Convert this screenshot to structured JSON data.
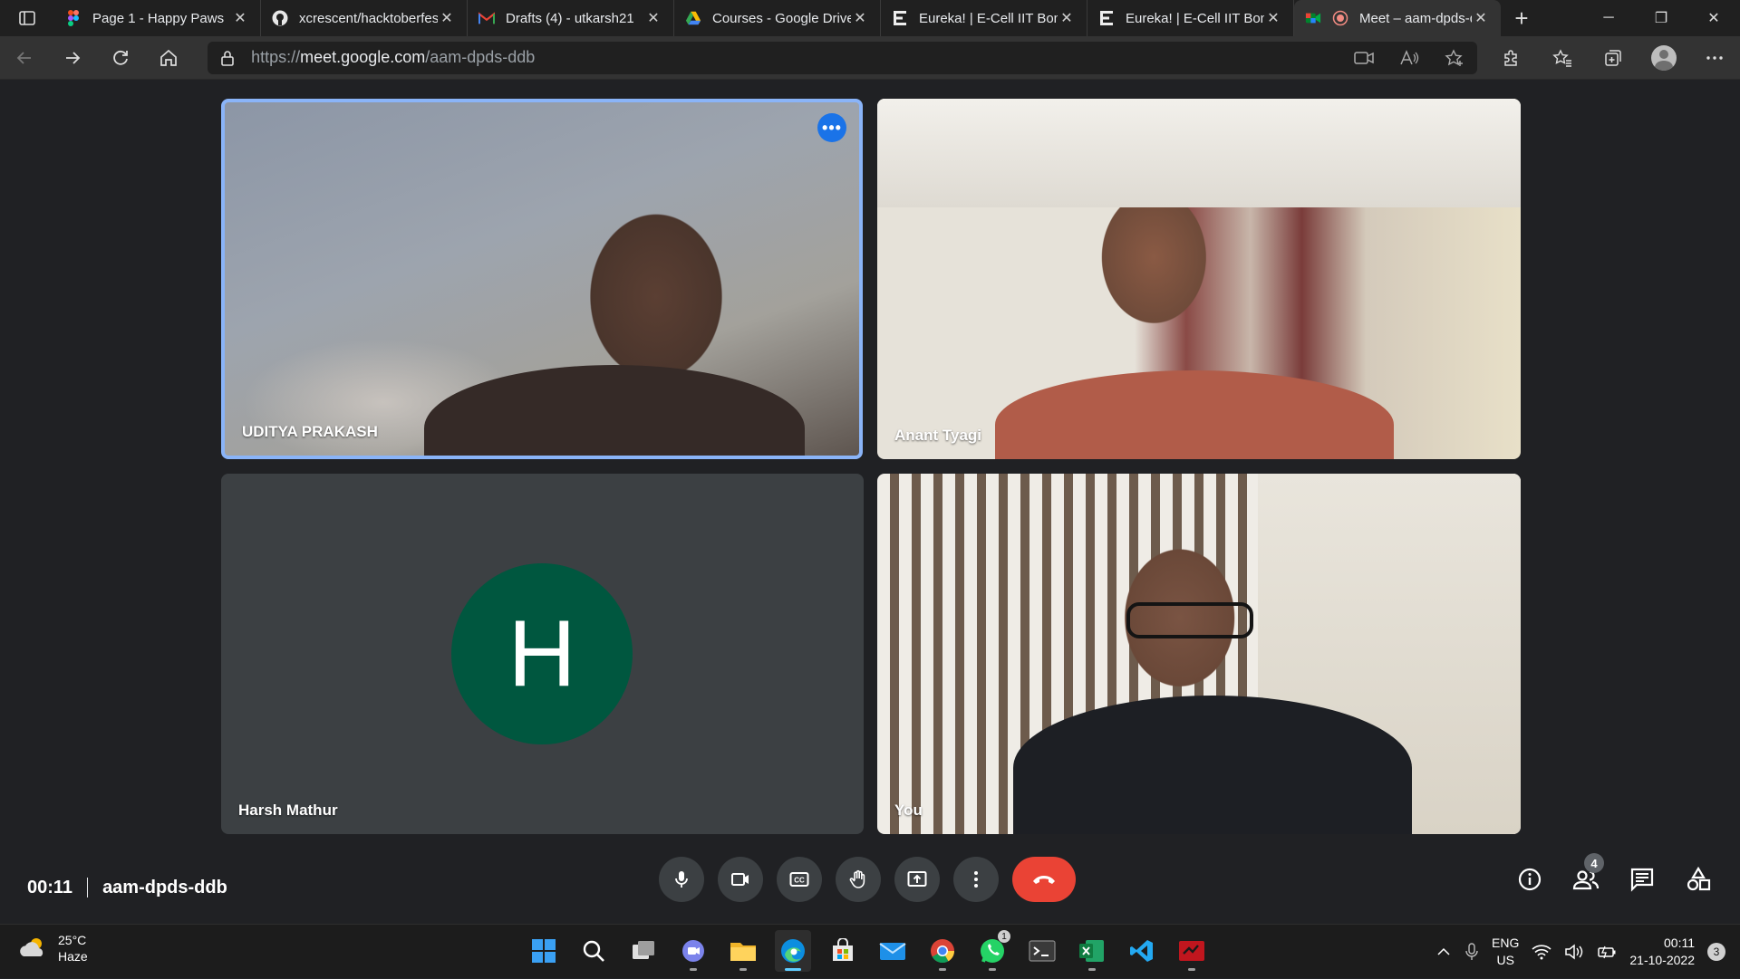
{
  "browser": {
    "tabs": [
      {
        "title": "Page 1 - Happy Paws",
        "icon": "figma-icon"
      },
      {
        "title": "xcrescent/hacktoberfest",
        "icon": "github-icon"
      },
      {
        "title": "Drafts (4) - utkarsh21",
        "icon": "gmail-icon"
      },
      {
        "title": "Courses - Google Drive",
        "icon": "google-drive-icon"
      },
      {
        "title": "Eureka! | E-Cell IIT Bombay",
        "icon": "eureka-icon"
      },
      {
        "title": "Eureka! | E-Cell IIT Bombay",
        "icon": "eureka-icon"
      },
      {
        "title": "Meet – aam-dpds-ddb",
        "icon": "google-meet-icon"
      }
    ],
    "close_glyph": "✕",
    "new_tab_glyph": "+",
    "window_controls": {
      "minimize": "─",
      "restore": "❐",
      "close": "✕"
    },
    "url_prefix": "https://",
    "url_domain": "meet.google.com",
    "url_path": "/aam-dpds-ddb"
  },
  "meet": {
    "participants": [
      {
        "name": "UDITYA PRAKASH",
        "speaking": true
      },
      {
        "name": "Anant Tyagi"
      },
      {
        "name": "Harsh Mathur",
        "avatar_letter": "H",
        "avatar_color": "#00573f"
      },
      {
        "name": "You"
      }
    ],
    "tile_menu_glyph": "•••",
    "time": "00:11",
    "meeting_code": "aam-dpds-ddb",
    "people_count": "4",
    "accent_color": "#8ab4f8",
    "end_call_color": "#ea4335"
  },
  "taskbar": {
    "weather_temp": "25°C",
    "weather_desc": "Haze",
    "whatsapp_badge": "1",
    "lang_line1": "ENG",
    "lang_line2": "US",
    "clock_time": "00:11",
    "clock_date": "21-10-2022",
    "notification_count": "3"
  }
}
